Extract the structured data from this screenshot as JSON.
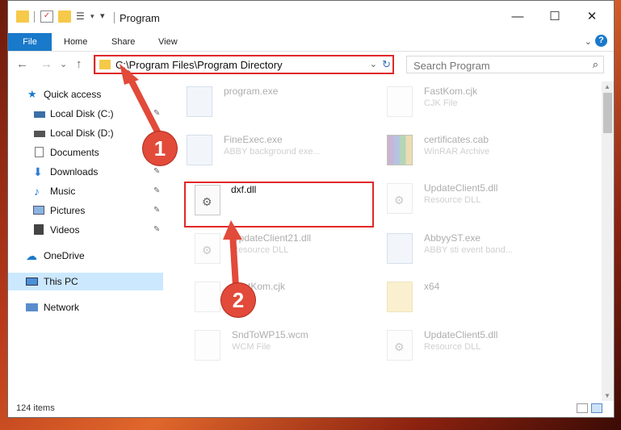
{
  "window": {
    "title": "Program",
    "buttons": {
      "minimize": "—",
      "maximize": "☐",
      "close": "✕"
    }
  },
  "ribbon": {
    "tabs": [
      "File",
      "Home",
      "Share",
      "View"
    ],
    "expand_icon": "chevron-down-icon",
    "help_icon": "?"
  },
  "navigation": {
    "back": "←",
    "forward": "→",
    "recent": "⌄",
    "up": "↑",
    "address": "C:\\Program Files\\Program Directory",
    "refresh": "↻",
    "dropdown": "⌄"
  },
  "search": {
    "placeholder": "Search Program",
    "icon": "⌕"
  },
  "sidebar": {
    "items": [
      {
        "label": "Quick access",
        "icon": "star-icon",
        "pinned": false
      },
      {
        "label": "Local Disk (C:)",
        "icon": "drive-icon",
        "pinned": true
      },
      {
        "label": "Local Disk (D:)",
        "icon": "drive-icon",
        "pinned": true
      },
      {
        "label": "Documents",
        "icon": "document-icon",
        "pinned": true
      },
      {
        "label": "Downloads",
        "icon": "download-icon",
        "pinned": true
      },
      {
        "label": "Music",
        "icon": "music-icon",
        "pinned": true
      },
      {
        "label": "Pictures",
        "icon": "pictures-icon",
        "pinned": true
      },
      {
        "label": "Videos",
        "icon": "videos-icon",
        "pinned": true
      },
      {
        "label": "OneDrive",
        "icon": "cloud-icon",
        "pinned": false
      },
      {
        "label": "This PC",
        "icon": "computer-icon",
        "pinned": false,
        "selected": true
      },
      {
        "label": "Network",
        "icon": "network-icon",
        "pinned": false
      }
    ]
  },
  "files": [
    {
      "name": "program.exe",
      "desc": "",
      "type": "exe"
    },
    {
      "name": "FastKom.cjk",
      "desc": "CJK File",
      "type": "file"
    },
    {
      "name": "FineExec.exe",
      "desc": "ABBY background exe...",
      "type": "exe"
    },
    {
      "name": "certificates.cab",
      "desc": "WinRAR Archive",
      "type": "cab"
    },
    {
      "name": "dxf.dll",
      "desc": "",
      "type": "dll"
    },
    {
      "name": "UpdateClient5.dll",
      "desc": "Resource DLL",
      "type": "dll"
    },
    {
      "name": "UpdateClient21.dll",
      "desc": "Resource DLL",
      "type": "dll"
    },
    {
      "name": "AbbyyST.exe",
      "desc": "ABBY sti event band...",
      "type": "exe"
    },
    {
      "name": "FastKom.cjk",
      "desc": "",
      "type": "file"
    },
    {
      "name": "x64",
      "desc": "",
      "type": "folder"
    },
    {
      "name": "SndToWP15.wcm",
      "desc": "WCM File",
      "type": "file"
    },
    {
      "name": "UpdateClient5.dll",
      "desc": "Resource DLL",
      "type": "dll"
    }
  ],
  "status": {
    "item_count": "124 items"
  },
  "callouts": [
    "1",
    "2"
  ],
  "colors": {
    "accent": "#1979ca",
    "highlight": "#e02828",
    "selected": "#cce8ff",
    "callout": "#e24a3a"
  }
}
